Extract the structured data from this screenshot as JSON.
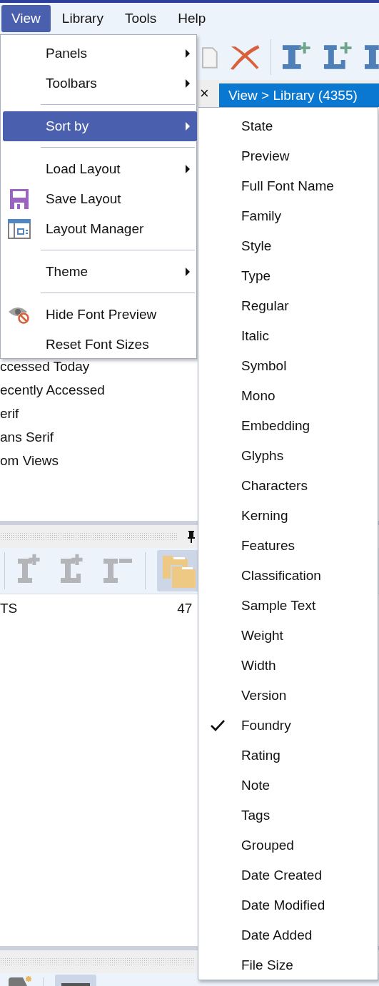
{
  "menubar": [
    {
      "label": "View",
      "selected": true
    },
    {
      "label": "Library",
      "selected": false
    },
    {
      "label": "Tools",
      "selected": false
    },
    {
      "label": "Help",
      "selected": false
    }
  ],
  "tab_close": "×",
  "library_tab": {
    "label": "View > Library (4355)"
  },
  "library_list": [
    "ccessed Today",
    "ecently Accessed",
    "erif",
    "ans Serif",
    "om Views"
  ],
  "font_list_row": {
    "column_1": "TS",
    "column_2": "47"
  },
  "view_menu": {
    "items": [
      {
        "kind": "item",
        "label": "Panels",
        "submenu": true,
        "selected": false
      },
      {
        "kind": "item",
        "label": "Toolbars",
        "submenu": true,
        "selected": false
      },
      {
        "kind": "separator"
      },
      {
        "kind": "item",
        "label": "Sort by",
        "submenu": true,
        "selected": true
      },
      {
        "kind": "separator"
      },
      {
        "kind": "item",
        "label": "Load Layout",
        "submenu": true,
        "selected": false
      },
      {
        "kind": "item",
        "label": "Save Layout",
        "submenu": false,
        "selected": false
      },
      {
        "kind": "item",
        "label": "Layout Manager",
        "submenu": false,
        "selected": false
      },
      {
        "kind": "separator"
      },
      {
        "kind": "item",
        "label": "Theme",
        "submenu": true,
        "selected": false
      },
      {
        "kind": "separator"
      },
      {
        "kind": "item",
        "label": "Hide Font Preview",
        "submenu": false,
        "selected": false
      },
      {
        "kind": "item",
        "label": "Reset Font Sizes",
        "submenu": false,
        "selected": false
      }
    ]
  },
  "sort_by_menu": {
    "items": [
      {
        "label": "State",
        "checked": false
      },
      {
        "label": "Preview",
        "checked": false
      },
      {
        "label": "Full Font Name",
        "checked": false
      },
      {
        "label": "Family",
        "checked": false
      },
      {
        "label": "Style",
        "checked": false
      },
      {
        "label": "Type",
        "checked": false
      },
      {
        "label": "Regular",
        "checked": false
      },
      {
        "label": "Italic",
        "checked": false
      },
      {
        "label": "Symbol",
        "checked": false
      },
      {
        "label": "Mono",
        "checked": false
      },
      {
        "label": "Embedding",
        "checked": false
      },
      {
        "label": "Glyphs",
        "checked": false
      },
      {
        "label": "Characters",
        "checked": false
      },
      {
        "label": "Kerning",
        "checked": false
      },
      {
        "label": "Features",
        "checked": false
      },
      {
        "label": "Classification",
        "checked": false
      },
      {
        "label": "Sample Text",
        "checked": false
      },
      {
        "label": "Weight",
        "checked": false
      },
      {
        "label": "Width",
        "checked": false
      },
      {
        "label": "Version",
        "checked": false
      },
      {
        "label": "Foundry",
        "checked": true
      },
      {
        "label": "Rating",
        "checked": false
      },
      {
        "label": "Note",
        "checked": false
      },
      {
        "label": "Tags",
        "checked": false
      },
      {
        "label": "Grouped",
        "checked": false
      },
      {
        "label": "Date Created",
        "checked": false
      },
      {
        "label": "Date Modified",
        "checked": false
      },
      {
        "label": "Date Added",
        "checked": false
      },
      {
        "label": "File Size",
        "checked": false
      }
    ]
  }
}
